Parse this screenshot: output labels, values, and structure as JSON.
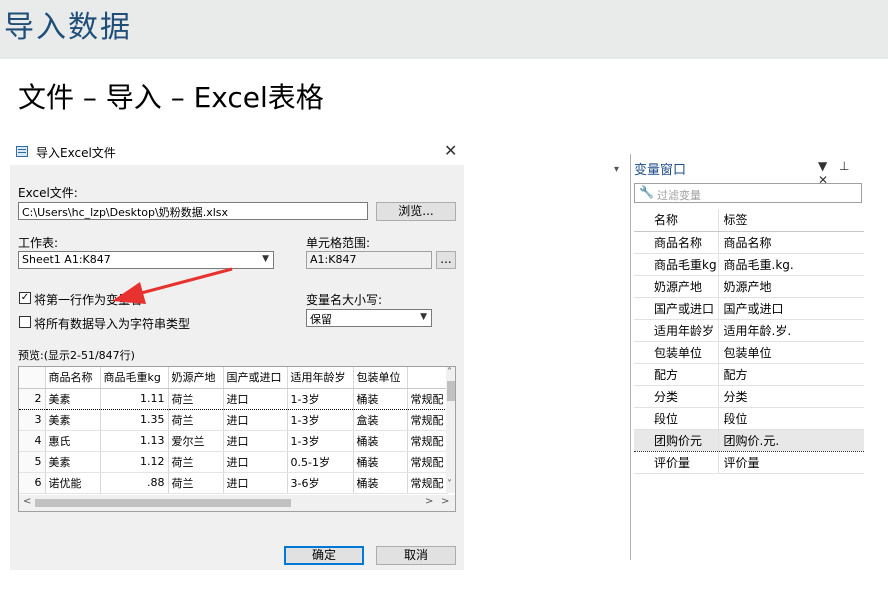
{
  "slide": {
    "title": "导入数据",
    "subtitle": "文件 – 导入 – Excel表格"
  },
  "dialog": {
    "title": "导入Excel文件",
    "close_glyph": "✕",
    "excel_file_label": "Excel文件:",
    "excel_file_value": "C:\\Users\\hc_lzp\\Desktop\\奶粉数据.xlsx",
    "browse_label": "浏览...",
    "worksheet_label": "工作表:",
    "worksheet_value": "Sheet1 A1:K847",
    "cell_range_label": "单元格范围:",
    "cell_range_value": "A1:K847",
    "range_button_label": "...",
    "first_row_names_label": "将第一行作为变量名",
    "first_row_names_checked": true,
    "import_as_string_label": "将所有数据导入为字符串类型",
    "import_as_string_checked": false,
    "case_label": "变量名大小写:",
    "case_value": "保留",
    "preview_label": "预览:(显示2-51/847行)",
    "ok_label": "确定",
    "cancel_label": "取消",
    "preview": {
      "headers": [
        "商品名称",
        "商品毛重kg",
        "奶源产地",
        "国产或进口",
        "适用年龄岁",
        "包装单位",
        ""
      ],
      "rows": [
        {
          "n": "2",
          "cells": [
            "美素",
            "1.11",
            "荷兰",
            "进口",
            "1-3岁",
            "桶装",
            "常规配"
          ]
        },
        {
          "n": "3",
          "cells": [
            "美素",
            "1.35",
            "荷兰",
            "进口",
            "1-3岁",
            "盒装",
            "常规配"
          ]
        },
        {
          "n": "4",
          "cells": [
            "惠氏",
            "1.13",
            "爱尔兰",
            "进口",
            "1-3岁",
            "桶装",
            "常规配"
          ]
        },
        {
          "n": "5",
          "cells": [
            "美素",
            "1.12",
            "荷兰",
            "进口",
            "0.5-1岁",
            "桶装",
            "常规配"
          ]
        },
        {
          "n": "6",
          "cells": [
            "诺优能",
            ".88",
            "荷兰",
            "进口",
            "3-6岁",
            "桶装",
            "常规配"
          ]
        }
      ]
    }
  },
  "variable_window": {
    "title": "变量窗口",
    "tools": "▼ ⊥ ✕",
    "filter_placeholder": "过滤变量",
    "col_name": "名称",
    "col_label": "标签",
    "items": [
      {
        "name": "商品名称",
        "label": "商品名称"
      },
      {
        "name": "商品毛重kg",
        "label": "商品毛重.kg."
      },
      {
        "name": "奶源产地",
        "label": "奶源产地"
      },
      {
        "name": "国产或进口",
        "label": "国产或进口"
      },
      {
        "name": "适用年龄岁",
        "label": "适用年龄.岁."
      },
      {
        "name": "包装单位",
        "label": "包装单位"
      },
      {
        "name": "配方",
        "label": "配方"
      },
      {
        "name": "分类",
        "label": "分类"
      },
      {
        "name": "段位",
        "label": "段位"
      },
      {
        "name": "团购价元",
        "label": "团购价.元."
      },
      {
        "name": "评价量",
        "label": "评价量"
      }
    ]
  }
}
